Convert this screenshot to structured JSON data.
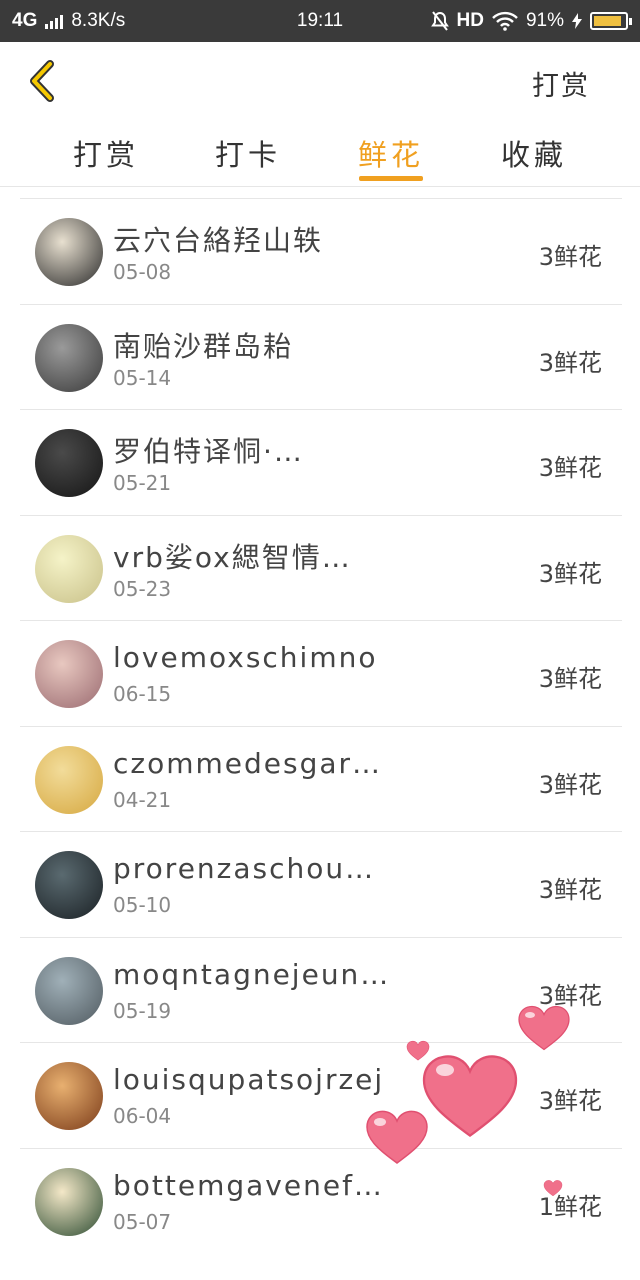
{
  "status": {
    "network": "4G",
    "speed": "8.3K/s",
    "time": "19:11",
    "hd": "HD",
    "battery": "91%",
    "battery_level": 0.91
  },
  "header": {
    "action_label": "打赏"
  },
  "tabs": [
    {
      "label": "打赏",
      "active": false
    },
    {
      "label": "打卡",
      "active": false
    },
    {
      "label": "鲜花",
      "active": true
    },
    {
      "label": "收藏",
      "active": false
    }
  ],
  "rows": [
    {
      "name": "云穴台絡羟山轶",
      "date": "05-08",
      "amount": "3鲜花",
      "avatar_colors": [
        "#e8e0d0",
        "#2a2a2a"
      ]
    },
    {
      "name": "南贻沙群岛耛",
      "date": "05-14",
      "amount": "3鲜花",
      "avatar_colors": [
        "#9a9a9a",
        "#3a3a3a"
      ]
    },
    {
      "name": "罗伯特译恫·…",
      "date": "05-21",
      "amount": "3鲜花",
      "avatar_colors": [
        "#4a4a4a",
        "#151515"
      ]
    },
    {
      "name": "vrb娑ox緦智情…",
      "date": "05-23",
      "amount": "3鲜花",
      "avatar_colors": [
        "#f5f3c8",
        "#c8c088"
      ]
    },
    {
      "name": "lovemoxschimno",
      "date": "06-15",
      "amount": "3鲜花",
      "avatar_colors": [
        "#e8c8c0",
        "#9a6a70"
      ]
    },
    {
      "name": "czommedesgar…",
      "date": "04-21",
      "amount": "3鲜花",
      "avatar_colors": [
        "#f2dc9a",
        "#d6a840"
      ]
    },
    {
      "name": "prorenzaschou…",
      "date": "05-10",
      "amount": "3鲜花",
      "avatar_colors": [
        "#5a6a70",
        "#1a2024"
      ]
    },
    {
      "name": "moqntagnejeun…",
      "date": "05-19",
      "amount": "3鲜花",
      "avatar_colors": [
        "#a0b0b8",
        "#505a60"
      ]
    },
    {
      "name": "louisqupatsojrzej",
      "date": "06-04",
      "amount": "3鲜花",
      "avatar_colors": [
        "#e8b070",
        "#7a3a18"
      ]
    },
    {
      "name": "bottemgavenef…",
      "date": "05-07",
      "amount": "1鲜花",
      "avatar_colors": [
        "#f4e8c8",
        "#2a4a30"
      ]
    }
  ],
  "icons": {
    "back": "chevron-left-icon",
    "hearts": "hearts-icon"
  },
  "colors": {
    "accent": "#f0a020",
    "status_bar": "#3a3a3a",
    "heart": "#f0708a"
  }
}
